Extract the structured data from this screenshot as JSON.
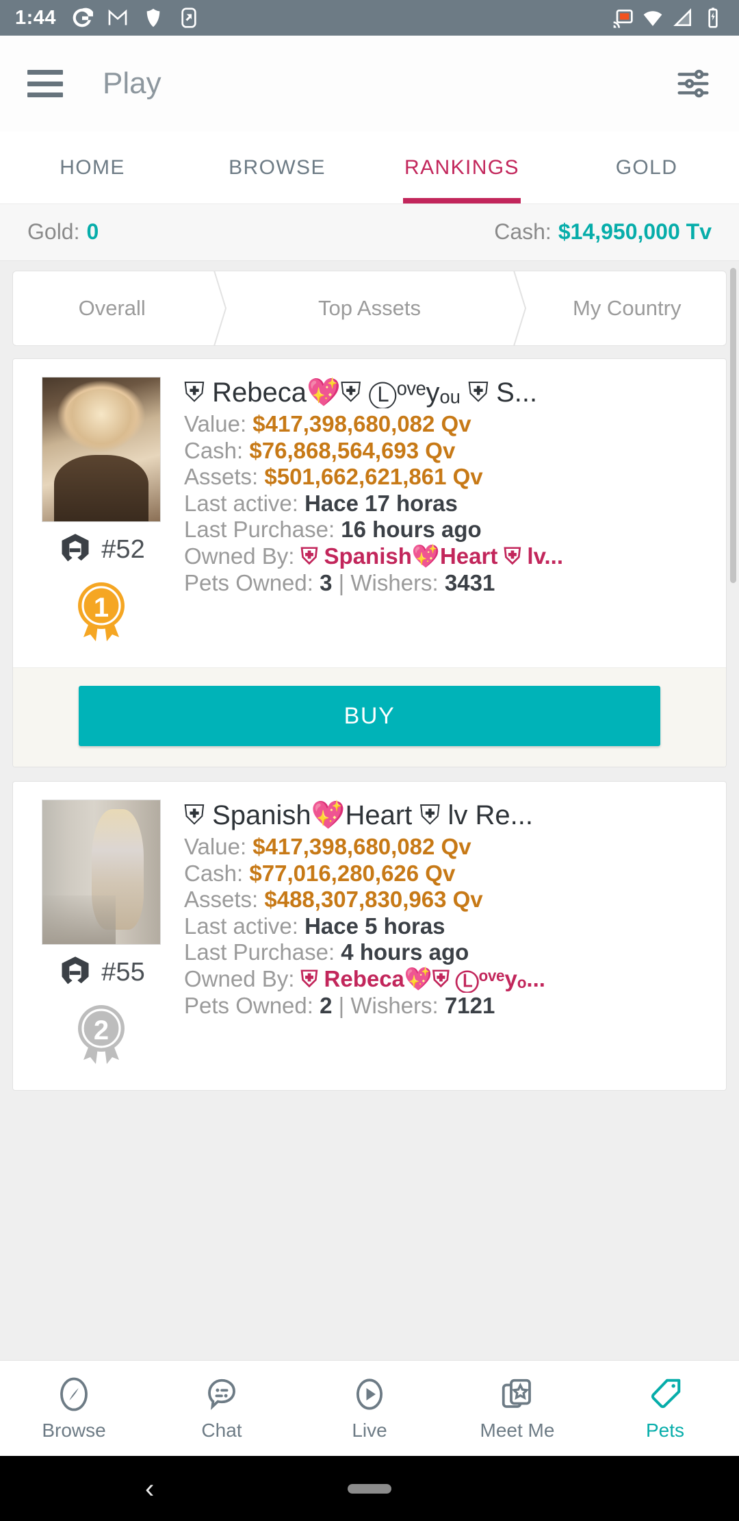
{
  "status_bar": {
    "time": "1:44",
    "left_icons": [
      "google-icon",
      "gmail-icon",
      "shield-icon",
      "screenshot-icon"
    ],
    "right_icons": [
      "cast-icon",
      "wifi-icon",
      "signal-icon",
      "battery-icon"
    ],
    "background_color": "#6d7b85"
  },
  "app_bar": {
    "menu_icon": "hamburger-menu-icon",
    "title": "Play",
    "filter_icon": "tune-filter-icon"
  },
  "tabs": {
    "items": [
      {
        "label": "HOME",
        "active": false
      },
      {
        "label": "BROWSE",
        "active": false
      },
      {
        "label": "RANKINGS",
        "active": true
      },
      {
        "label": "GOLD",
        "active": false
      }
    ],
    "active_color": "#c2265b",
    "inactive_color": "#6d7b85"
  },
  "money_bar": {
    "gold_label": "Gold:",
    "gold_value": "0",
    "cash_label": "Cash:",
    "cash_value": "$14,950,000 Tv",
    "accent_color": "#06adaa"
  },
  "segmented": {
    "items": [
      {
        "label": "Overall",
        "active": false
      },
      {
        "label": "Top Assets",
        "active": false
      },
      {
        "label": "My Country",
        "active": false
      }
    ]
  },
  "cards": [
    {
      "username": "⛨ Rebeca💖⛨ Ⓛᵒᵛᵉyₒᵤ ⛨ S...",
      "rank": "#52",
      "medal": "1",
      "medal_color": "#f5a623",
      "stats": [
        {
          "label": "Value:",
          "value": "$417,398,680,082 Qv",
          "style": "amount"
        },
        {
          "label": "Cash:",
          "value": "$76,868,564,693 Qv",
          "style": "amount"
        },
        {
          "label": "Assets:",
          "value": "$501,662,621,861 Qv",
          "style": "amount"
        },
        {
          "label": "Last active:",
          "value": "Hace 17 horas",
          "style": "dark"
        },
        {
          "label": "Last Purchase:",
          "value": "16 hours ago",
          "style": "dark"
        },
        {
          "label": "Owned By:",
          "value": "⛨ Spanish💖Heart ⛨ lv...",
          "style": "owner"
        },
        {
          "label": "Pets Owned:",
          "value": "3",
          "style": "pets",
          "extra_label": "| Wishers:",
          "extra_value": "3431"
        }
      ],
      "buy_label": "BUY",
      "has_buy": true
    },
    {
      "username": "⛨ Spanish💖Heart ⛨ lv Re...",
      "rank": "#55",
      "medal": "2",
      "medal_color": "#bdbdbd",
      "stats": [
        {
          "label": "Value:",
          "value": "$417,398,680,082 Qv",
          "style": "amount"
        },
        {
          "label": "Cash:",
          "value": "$77,016,280,626 Qv",
          "style": "amount"
        },
        {
          "label": "Assets:",
          "value": "$488,307,830,963 Qv",
          "style": "amount"
        },
        {
          "label": "Last active:",
          "value": "Hace 5 horas",
          "style": "dark"
        },
        {
          "label": "Last Purchase:",
          "value": "4 hours ago",
          "style": "dark"
        },
        {
          "label": "Owned By:",
          "value": "⛨ Rebeca💖⛨ Ⓛᵒᵛᵉyₒ...",
          "style": "owner"
        },
        {
          "label": "Pets Owned:",
          "value": "2",
          "style": "pets",
          "extra_label": "| Wishers:",
          "extra_value": "7121"
        }
      ],
      "buy_label": "BUY",
      "has_buy": false
    }
  ],
  "bottom_nav": {
    "items": [
      {
        "label": "Browse",
        "icon": "compass-icon",
        "active": false
      },
      {
        "label": "Chat",
        "icon": "chat-bubble-icon",
        "active": false
      },
      {
        "label": "Live",
        "icon": "play-circle-icon",
        "active": false
      },
      {
        "label": "Meet Me",
        "icon": "star-cards-icon",
        "active": false
      },
      {
        "label": "Pets",
        "icon": "price-tag-icon",
        "active": true
      }
    ],
    "active_color": "#06adaa"
  },
  "android_nav": {
    "back_glyph": "‹",
    "home_pill": ""
  }
}
